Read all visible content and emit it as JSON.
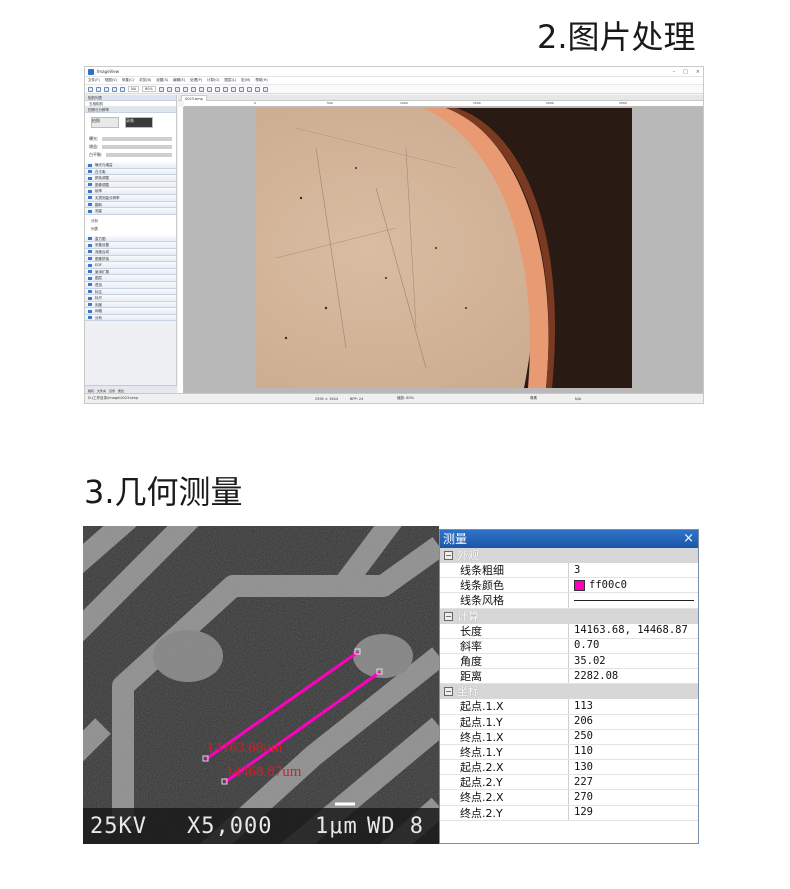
{
  "headings": {
    "image_processing": "2.图片处理",
    "measurement": "3.几何测量"
  },
  "app": {
    "title": "ImageView",
    "window_buttons": [
      "–",
      "□",
      "×"
    ],
    "menu": [
      "文件(F)",
      "视图(V)",
      "采集(C)",
      "浏览(B)",
      "设置(S)",
      "编辑(E)",
      "处理(P)",
      "计算(O)",
      "图层(L)",
      "宏(M)",
      "帮助(H)"
    ],
    "toolbar_zoom": "NA",
    "toolbar_pct": "60%",
    "left_panel": {
      "camera_title": "相机列表",
      "camera_name": "五相相机",
      "capture_title": "拍照与分辨率",
      "btn_snap": "拍照",
      "btn_record": "录像",
      "labels": [
        "曝光:",
        "增益:",
        "白平衡:"
      ],
      "sections": [
        "曝光与增益",
        "白平衡",
        "颜色调整",
        "图像调整",
        "帧率",
        "无损测量分辨率",
        "翻转",
        "测量",
        "直方图",
        "采集设置",
        "深度合成",
        "图像拼接",
        "EDF",
        "景深扩展",
        "图层",
        "叠加",
        "标注",
        "标尺",
        "刻度",
        "网格",
        "分析"
      ],
      "sub_items": [
        "分析",
        "列表"
      ],
      "footer_tabs": [
        "相机",
        "文件夹",
        "目录",
        "属性"
      ]
    },
    "tab_label": "0023.bmp",
    "ruler_ticks": [
      "0",
      "500",
      "1000",
      "1500",
      "2000",
      "2500"
    ],
    "status": {
      "path": "D:\\工作目录\\image\\0023.bmp",
      "size": "2592 × 1944",
      "bpp": "BPP: 24",
      "zoom": "缩放: 60%",
      "mode": "像素",
      "na": "N/A"
    }
  },
  "sem": {
    "voltage": "25KV",
    "magnification": "X5,000",
    "scale": "1μm",
    "wd": "WD 8",
    "label1": "14163.68um",
    "label2": "14468.87um"
  },
  "measure_panel": {
    "title": "测量",
    "close": "×",
    "categories": {
      "appearance": "外观",
      "compute": "计算",
      "coords": "坐标"
    },
    "appearance_rows": [
      {
        "k": "线条粗细",
        "v": "3"
      },
      {
        "k": "线条颜色",
        "v": "ff00c0"
      },
      {
        "k": "线条风格",
        "v": ""
      }
    ],
    "compute_rows": [
      {
        "k": "长度",
        "v": "14163.68, 14468.87"
      },
      {
        "k": "斜率",
        "v": "0.70"
      },
      {
        "k": "角度",
        "v": "35.02"
      },
      {
        "k": "距离",
        "v": "2282.08"
      }
    ],
    "coord_rows": [
      {
        "k": "起点.1.X",
        "v": "113"
      },
      {
        "k": "起点.1.Y",
        "v": "206"
      },
      {
        "k": "终点.1.X",
        "v": "250"
      },
      {
        "k": "终点.1.Y",
        "v": "110"
      },
      {
        "k": "起点.2.X",
        "v": "130"
      },
      {
        "k": "起点.2.Y",
        "v": "227"
      },
      {
        "k": "终点.2.X",
        "v": "270"
      },
      {
        "k": "终点.2.Y",
        "v": "129"
      }
    ],
    "line_color": "#ff00c0"
  }
}
